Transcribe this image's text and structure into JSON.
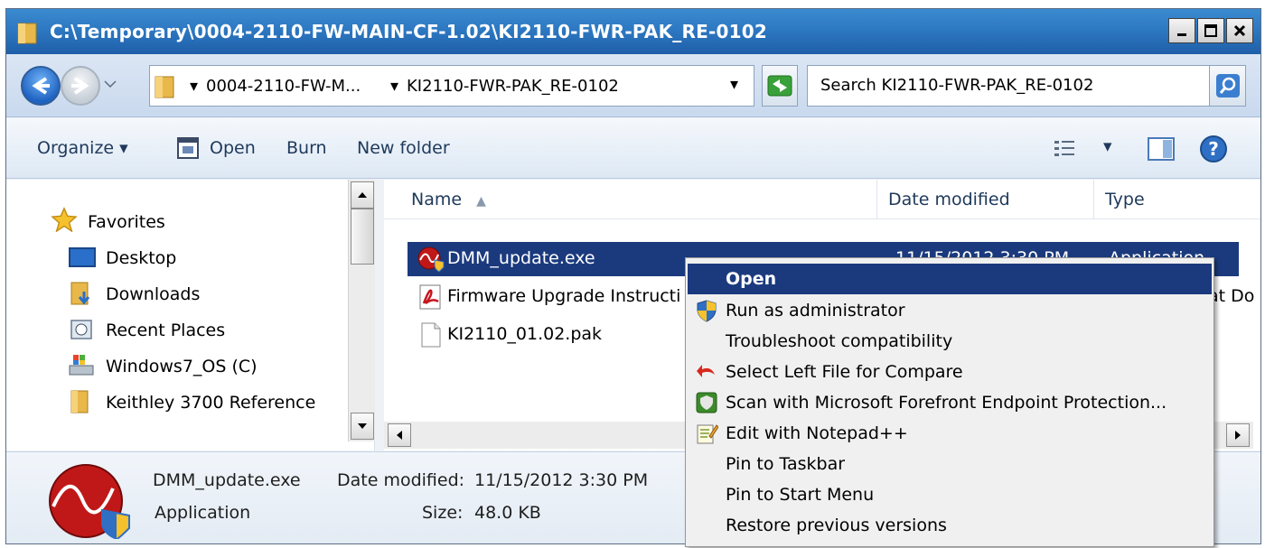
{
  "window": {
    "title": "C:\\Temporary\\0004-2110-FW-MAIN-CF-1.02\\KI2110-FWR-PAK_RE-0102",
    "minimize_label": "minimize",
    "maximize_label": "maximize",
    "close_label": "close"
  },
  "address": {
    "crumb1": "0004-2110-FW-M...",
    "crumb2": "KI2110-FWR-PAK_RE-0102",
    "search_placeholder": "Search KI2110-FWR-PAK_RE-0102"
  },
  "toolbar": {
    "organize": "Organize",
    "open": "Open",
    "burn": "Burn",
    "new_folder": "New folder"
  },
  "nav": {
    "favorites": "Favorites",
    "items": [
      "Desktop",
      "Downloads",
      "Recent Places",
      "Windows7_OS (C)",
      "Keithley 3700 Reference"
    ]
  },
  "columns": {
    "name": "Name",
    "date_modified": "Date modified",
    "type": "Type"
  },
  "files": [
    {
      "name": "DMM_update.exe",
      "date": "11/15/2012 3:30 PM",
      "type": "Application",
      "icon": "exe-icon"
    },
    {
      "name": "Firmware Upgrade Instructi",
      "date": "",
      "type": "at Do",
      "icon": "pdf-icon"
    },
    {
      "name": "KI2110_01.02.pak",
      "date": "",
      "type": "",
      "icon": "file-icon"
    }
  ],
  "context_menu": {
    "items": [
      {
        "label": "Open",
        "icon": ""
      },
      {
        "label": "Run as administrator",
        "icon": "shield-icon"
      },
      {
        "label": "Troubleshoot compatibility",
        "icon": ""
      },
      {
        "label": "Select Left File for Compare",
        "icon": "compare-icon"
      },
      {
        "label": "Scan with Microsoft Forefront Endpoint Protection...",
        "icon": "forefront-icon"
      },
      {
        "label": "Edit with Notepad++",
        "icon": "notepad-icon"
      },
      {
        "label": "Pin to Taskbar",
        "icon": ""
      },
      {
        "label": "Pin to Start Menu",
        "icon": ""
      },
      {
        "label": "Restore previous versions",
        "icon": ""
      }
    ]
  },
  "details": {
    "filename": "DMM_update.exe",
    "date_label": "Date modified:",
    "date_value": "11/15/2012 3:30 PM",
    "type": "Application",
    "size_label": "Size:",
    "size_value": "48.0 KB"
  },
  "colors": {
    "selection": "#1b3a7e",
    "titlebar": "#2d78c2",
    "menu_bg": "#f0f0f0"
  }
}
